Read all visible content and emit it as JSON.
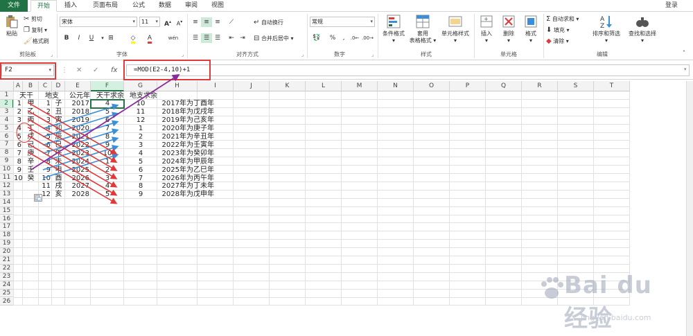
{
  "ribbon": {
    "tabs": [
      "文件",
      "开始",
      "插入",
      "页面布局",
      "公式",
      "数据",
      "审阅",
      "视图"
    ],
    "login": "登录",
    "clipboard": {
      "paste": "粘贴",
      "cut": "剪切",
      "copy": "复制",
      "format_painter": "格式刷",
      "label": "剪贴板"
    },
    "font": {
      "name": "宋体",
      "size": "11",
      "label": "字体",
      "bold": "B",
      "italic": "I",
      "underline": "U",
      "grow": "A",
      "shrink": "A",
      "wen": "wén"
    },
    "alignment": {
      "wrap": "自动换行",
      "merge": "合并后居中",
      "label": "对齐方式"
    },
    "number": {
      "format": "常规",
      "percent": "%",
      "comma": ",",
      "label": "数字"
    },
    "styles": {
      "conditional": "条件格式",
      "table_line1": "套用",
      "table_line2": "表格格式",
      "cell_styles": "单元格样式",
      "label": "样式"
    },
    "cells": {
      "insert": "插入",
      "delete": "删除",
      "format": "格式",
      "label": "单元格"
    },
    "editing": {
      "autosum": "自动求和",
      "fill": "填充",
      "clear": "清除",
      "sort": "排序和筛选",
      "find": "查找和选择",
      "label": "编辑"
    }
  },
  "formula_bar": {
    "name_box": "F2",
    "fx": "fx",
    "formula": "=MOD(E2-4,10)+1"
  },
  "grid": {
    "columns": [
      "A",
      "B",
      "C",
      "D",
      "E",
      "F",
      "G",
      "H",
      "I",
      "J",
      "K",
      "L",
      "M",
      "N",
      "O",
      "P",
      "Q",
      "R",
      "S",
      "T"
    ],
    "rows": [
      "1",
      "2",
      "3",
      "4",
      "5",
      "6",
      "7",
      "8",
      "9",
      "10",
      "11",
      "12",
      "13",
      "14",
      "15",
      "16",
      "17",
      "18",
      "19",
      "20",
      "21",
      "22",
      "23",
      "24",
      "25",
      "26"
    ],
    "header_row": {
      "A": "天干",
      "C": "地支",
      "E": "公元年",
      "F": "天干求余",
      "G": "地支求余"
    },
    "col_a": [
      "1",
      "2",
      "3",
      "4",
      "5",
      "6",
      "7",
      "8",
      "9",
      "10"
    ],
    "col_b": [
      "甲",
      "乙",
      "丙",
      "丁",
      "戊",
      "己",
      "庚",
      "辛",
      "壬",
      "癸"
    ],
    "col_c": [
      "1",
      "2",
      "3",
      "4",
      "5",
      "6",
      "7",
      "8",
      "9",
      "10",
      "11",
      "12"
    ],
    "col_d": [
      "子",
      "丑",
      "寅",
      "卯",
      "辰",
      "巳",
      "午",
      "未",
      "申",
      "酉",
      "戌",
      "亥"
    ],
    "col_e": [
      "2017",
      "2018",
      "2019",
      "2020",
      "2021",
      "2022",
      "2023",
      "2024",
      "2025",
      "2026",
      "2027",
      "2028"
    ],
    "col_f": [
      "4",
      "5",
      "6",
      "7",
      "8",
      "9",
      "10",
      "1",
      "2",
      "3",
      "4",
      "5"
    ],
    "col_g": [
      "10",
      "11",
      "12",
      "1",
      "2",
      "3",
      "4",
      "5",
      "6",
      "7",
      "8",
      "9"
    ],
    "col_h": [
      "2017年为丁酉年",
      "2018年为戊戌年",
      "2019年为己亥年",
      "2020年为庚子年",
      "2021年为辛丑年",
      "2022年为壬寅年",
      "2023年为癸卯年",
      "2024年为甲辰年",
      "2025年为乙巳年",
      "2026年为丙午年",
      "2027年为丁未年",
      "2028年为戊申年"
    ]
  },
  "watermark": {
    "brand": "Bai du 经验",
    "url": "jingyan.baidu.com"
  },
  "colors": {
    "excel_green": "#217346",
    "annotation_red": "#e0393b",
    "arrow_blue": "#3c8fd6",
    "arrow_red": "#e0393b",
    "arrow_purple": "#8a2a9c"
  }
}
